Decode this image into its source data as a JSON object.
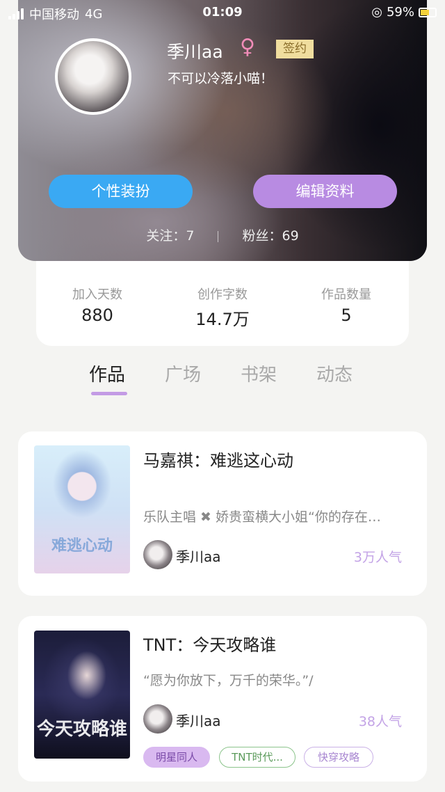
{
  "status_bar": {
    "carrier": "中国移动",
    "network": "4G",
    "time": "01:09",
    "battery": "59%"
  },
  "profile": {
    "username": "季川aa",
    "gender_symbol": "♀",
    "badge": "签约",
    "bio": "不可以冷落小喵！",
    "buttons": {
      "dress_up": "个性装扮",
      "edit_profile": "编辑资料"
    },
    "following_label": "关注：7",
    "followers_label": "粉丝：69"
  },
  "stats": [
    {
      "label": "加入天数",
      "value": "880"
    },
    {
      "label": "创作字数",
      "value": "14.7万"
    },
    {
      "label": "作品数量",
      "value": "5"
    }
  ],
  "tabs": [
    {
      "label": "作品",
      "active": true
    },
    {
      "label": "广场",
      "active": false
    },
    {
      "label": "书架",
      "active": false
    },
    {
      "label": "动态",
      "active": false
    }
  ],
  "works": [
    {
      "title": "马嘉祺：难逃这心动",
      "cover_text": "难逃心动",
      "description": "乐队主唱 ✖ 娇贵蛮横大小姐“你的存在…",
      "author": "季川aa",
      "popularity": "3万人气"
    },
    {
      "title": "TNT：今天攻略谁",
      "cover_text": "今天攻略谁",
      "description": "“愿为你放下，万千的荣华。”/",
      "author": "季川aa",
      "popularity": "38人气",
      "tags": [
        "明星同人",
        "TNT时代...",
        "快穿攻略"
      ]
    }
  ],
  "colors": {
    "accent_blue": "#3aa9f3",
    "accent_purple": "#b88be2",
    "popularity": "#c3a3e6",
    "gender_pink": "#f08cb8"
  }
}
